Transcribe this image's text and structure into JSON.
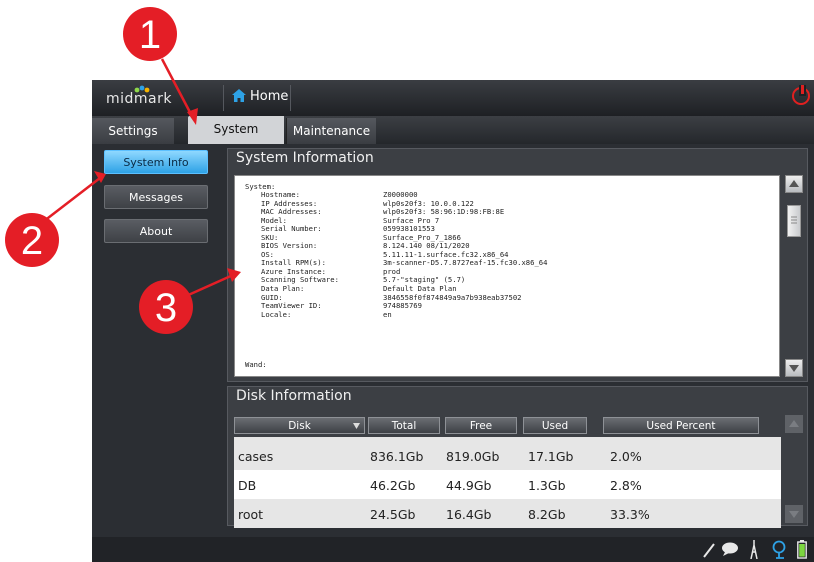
{
  "header": {
    "logo": "midmark",
    "home_label": "Home"
  },
  "tabs": [
    {
      "label": "Settings"
    },
    {
      "label": "System"
    },
    {
      "label": "Maintenance"
    }
  ],
  "sidebar": {
    "items": [
      {
        "label": "System Info"
      },
      {
        "label": "Messages"
      },
      {
        "label": "About"
      }
    ]
  },
  "system_info": {
    "title": "System Information",
    "section_label": "System:",
    "rows": [
      {
        "key": "Hostname:",
        "value": "Z0000000"
      },
      {
        "key": "IP Addresses:",
        "value": "wlp0s20f3: 10.0.0.122"
      },
      {
        "key": "MAC Addresses:",
        "value": "wlp0s20f3: 58:96:1D:98:FB:8E"
      },
      {
        "key": "Model:",
        "value": "Surface Pro 7"
      },
      {
        "key": "Serial Number:",
        "value": "059938101553"
      },
      {
        "key": "SKU:",
        "value": "Surface_Pro_7_1866"
      },
      {
        "key": "BIOS Version:",
        "value": "8.124.140  08/11/2020"
      },
      {
        "key": "OS:",
        "value": "5.11.11-1.surface.fc32.x86_64"
      },
      {
        "key": "Install RPM(s):",
        "value": "3m-scanner-D5.7.8727eaf-15.fc30.x86_64"
      },
      {
        "key": "Azure Instance:",
        "value": "prod"
      },
      {
        "key": "Scanning Software:",
        "value": "5.7-\"staging\" (5.7)"
      },
      {
        "key": "Data Plan:",
        "value": "Default Data Plan"
      },
      {
        "key": "GUID:",
        "value": "3846558f0f874849a9a7b938eab37502"
      },
      {
        "key": "TeamViewer ID:",
        "value": "974885769"
      },
      {
        "key": "Locale:",
        "value": "en"
      }
    ],
    "wand_label": "Wand:"
  },
  "disk_info": {
    "title": "Disk Information",
    "columns": [
      "Disk",
      "Total",
      "Free",
      "Used",
      "Used Percent"
    ],
    "rows": [
      [
        "cases",
        "836.1Gb",
        "819.0Gb",
        "17.1Gb",
        "2.0%"
      ],
      [
        "DB",
        "46.2Gb",
        "44.9Gb",
        "1.3Gb",
        "2.8%"
      ],
      [
        "root",
        "24.5Gb",
        "16.4Gb",
        "8.2Gb",
        "33.3%"
      ]
    ]
  },
  "annotations": [
    {
      "number": "1"
    },
    {
      "number": "2"
    },
    {
      "number": "3"
    }
  ],
  "colors": {
    "accent_active": "#2ea2e6",
    "callout_red": "#e41e26",
    "power_red": "#e02020"
  },
  "icons": [
    "home-icon",
    "power-icon",
    "pen-icon",
    "chat-icon",
    "pointer-icon",
    "headset-icon",
    "battery-icon",
    "sort-icon"
  ]
}
